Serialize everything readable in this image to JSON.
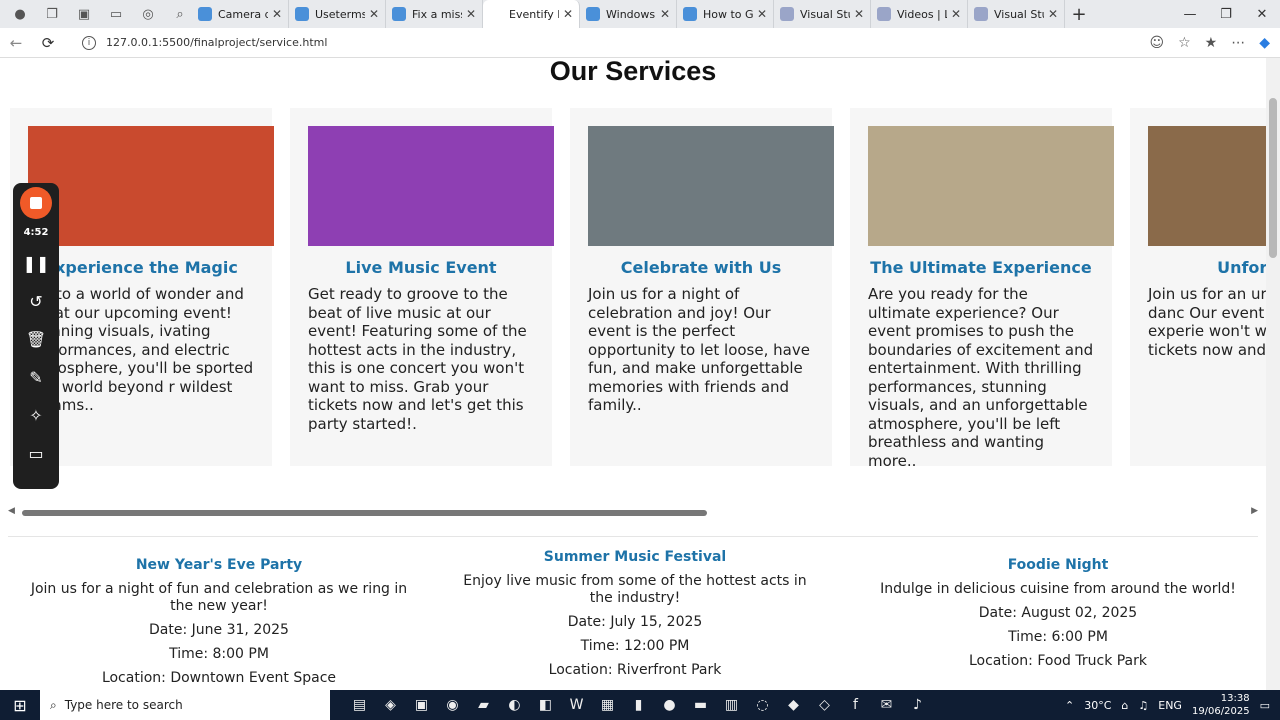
{
  "browser": {
    "tabs": [
      {
        "label": "Camera do",
        "color": "#4a90d9"
      },
      {
        "label": "Useterms",
        "color": "#4a90d9"
      },
      {
        "label": "Fix a missin",
        "color": "#4a90d9"
      },
      {
        "label": "Eventify Eve",
        "color": "#ffffff",
        "active": true
      },
      {
        "label": "Windows d",
        "color": "#4a90d9"
      },
      {
        "label": "How to Get",
        "color": "#4a90d9"
      },
      {
        "label": "Visual Stud",
        "color": "#9aa5c8"
      },
      {
        "label": "Videos | Lib",
        "color": "#9aa5c8"
      },
      {
        "label": "Visual Stud",
        "color": "#9aa5c8"
      }
    ],
    "url": "127.0.0.1:5500/finalproject/service.html"
  },
  "page": {
    "title": "Our Services",
    "cards": [
      {
        "heading": "Experience the Magic",
        "text": "p into a world of wonder and gic at our upcoming event! stunning visuals, ivating performances, and electric atmosphere, you'll be sported to a world beyond r wildest dreams..",
        "img_color": "#c94a2e"
      },
      {
        "heading": "Live Music Event",
        "text": "Get ready to groove to the beat of live music at our event! Featuring some of the hottest acts in the industry, this is one concert you won't want to miss. Grab your tickets now and let's get this party started!.",
        "img_color": "#8e3fb3"
      },
      {
        "heading": "Celebrate with Us",
        "text": "Join us for a night of celebration and joy! Our event is the perfect opportunity to let loose, have fun, and make unforgettable memories with friends and family..",
        "img_color": "#6f7a7f"
      },
      {
        "heading": "The Ultimate Experience",
        "text": "Are you ready for the ultimate experience? Our event promises to push the boundaries of excitement and entertainment. With thrilling performances, stunning visuals, and an unforgettable atmosphere, you'll be left breathless and wanting more..",
        "img_color": "#b7a88a"
      },
      {
        "heading": "Unforgett",
        "text": "Join us for an ur of music, danc Our event prom exciting experie won't want to m tickets now and fun!.",
        "img_color": "#8a6a4a"
      }
    ],
    "events": [
      {
        "title": "New Year's Eve Party",
        "desc": "Join us for a night of fun and celebration as we ring in the new year!",
        "date": "Date: June 31, 2025",
        "time": "Time: 8:00 PM",
        "location": "Location: Downtown Event Space"
      },
      {
        "title": "Summer Music Festival",
        "desc": "Enjoy live music from some of the hottest acts in the industry!",
        "date": "Date: July 15, 2025",
        "time": "Time: 12:00 PM",
        "location": "Location: Riverfront Park"
      },
      {
        "title": "Foodie Night",
        "desc": "Indulge in delicious cuisine from around the world!",
        "date": "Date: August 02, 2025",
        "time": "Time: 6:00 PM",
        "location": "Location: Food Truck Park"
      }
    ]
  },
  "recorder": {
    "time": "4:52"
  },
  "taskbar": {
    "search_placeholder": "Type here to search",
    "temperature": "30°C",
    "lang": "ENG",
    "time": "13:38",
    "date": "19/06/2025"
  }
}
